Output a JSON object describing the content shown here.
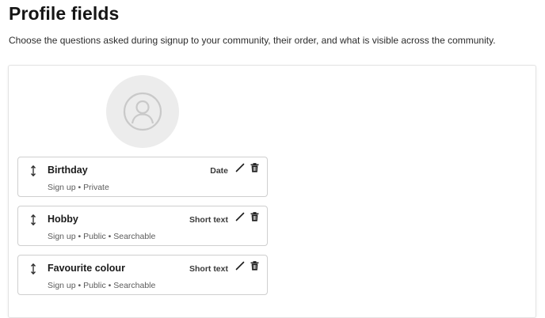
{
  "page": {
    "title": "Profile fields",
    "description": "Choose the questions asked during signup to your community, their order, and what is visible across the community."
  },
  "avatar": {
    "icon": "user-icon"
  },
  "fields": [
    {
      "name": "Birthday",
      "meta": "Sign up • Private",
      "type": "Date"
    },
    {
      "name": "Hobby",
      "meta": "Sign up • Public • Searchable",
      "type": "Short text"
    },
    {
      "name": "Favourite colour",
      "meta": "Sign up • Public • Searchable",
      "type": "Short text"
    }
  ],
  "icons": {
    "drag": "drag-handle-icon",
    "edit": "pencil-icon",
    "delete": "trash-icon"
  },
  "colors": {
    "avatar_bg": "#ececec",
    "border": "#cfcfcf",
    "text": "#1b1b1b"
  }
}
